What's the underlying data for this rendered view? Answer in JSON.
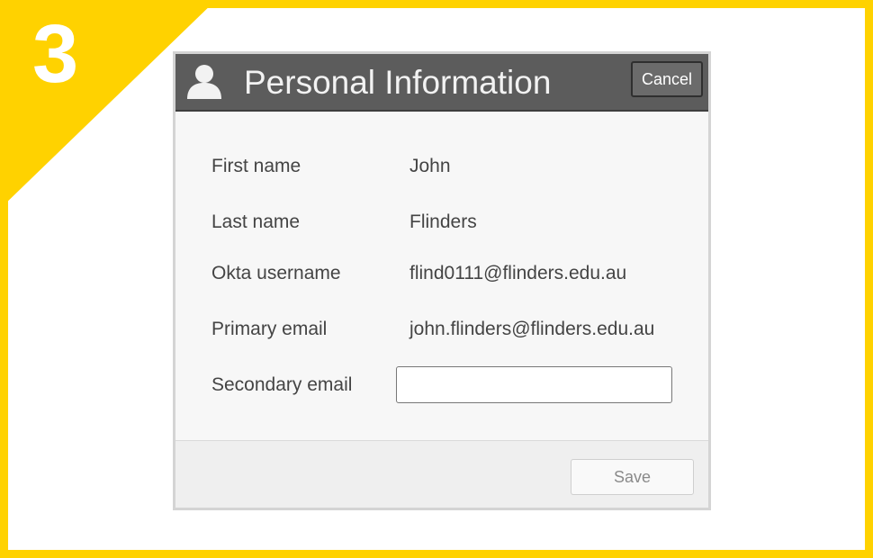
{
  "step": {
    "number": "3"
  },
  "dialog": {
    "title": "Personal Information",
    "header_icon": "person-icon",
    "cancel_label": "Cancel",
    "save_label": "Save"
  },
  "fields": {
    "first_name": {
      "label": "First name",
      "value": "John"
    },
    "last_name": {
      "label": "Last name",
      "value": "Flinders"
    },
    "okta_username": {
      "label": "Okta username",
      "value": "flind0111@flinders.edu.au"
    },
    "primary_email": {
      "label": "Primary email",
      "value": "john.flinders@flinders.edu.au"
    },
    "secondary_email": {
      "label": "Secondary email",
      "value": "",
      "placeholder": ""
    }
  },
  "colors": {
    "accent": "#ffd200",
    "titlebar": "#5c5c5c",
    "dialog_bg": "#f7f7f7"
  }
}
